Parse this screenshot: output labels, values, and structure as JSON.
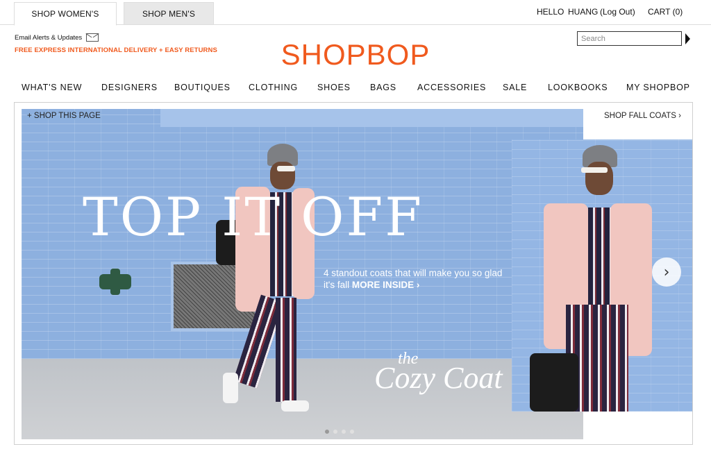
{
  "topbar": {
    "tab_women": "SHOP WOMEN'S",
    "tab_men": "SHOP MEN'S",
    "hello": "HELLO",
    "username": "HUANG",
    "logout": "(Log Out)",
    "cart": "CART (0)"
  },
  "header": {
    "email_alerts": "Email Alerts & Updates",
    "promo": "FREE EXPRESS INTERNATIONAL DELIVERY + EASY RETURNS",
    "logo": "SHOPBOP",
    "search_placeholder": "Search",
    "brand_color": "#f05a1e"
  },
  "nav": {
    "items": [
      "WHAT'S NEW",
      "DESIGNERS",
      "BOUTIQUES",
      "CLOTHING",
      "SHOES",
      "BAGS",
      "ACCESSORIES",
      "SALE",
      "LOOKBOOKS",
      "MY SHOPBOP"
    ]
  },
  "hero": {
    "shop_this_page": "+ SHOP THIS PAGE",
    "headline": "TOP IT OFF",
    "subcopy": "4 standout coats that will make you so glad it's fall",
    "more_inside": "MORE INSIDE ›",
    "cozy_the": "the",
    "cozy_main": "Cozy Coat",
    "shop_fall_coats": "SHOP FALL COATS ›",
    "next_icon": "chevron-right-icon",
    "slides_total": 4,
    "active_slide": 1
  }
}
